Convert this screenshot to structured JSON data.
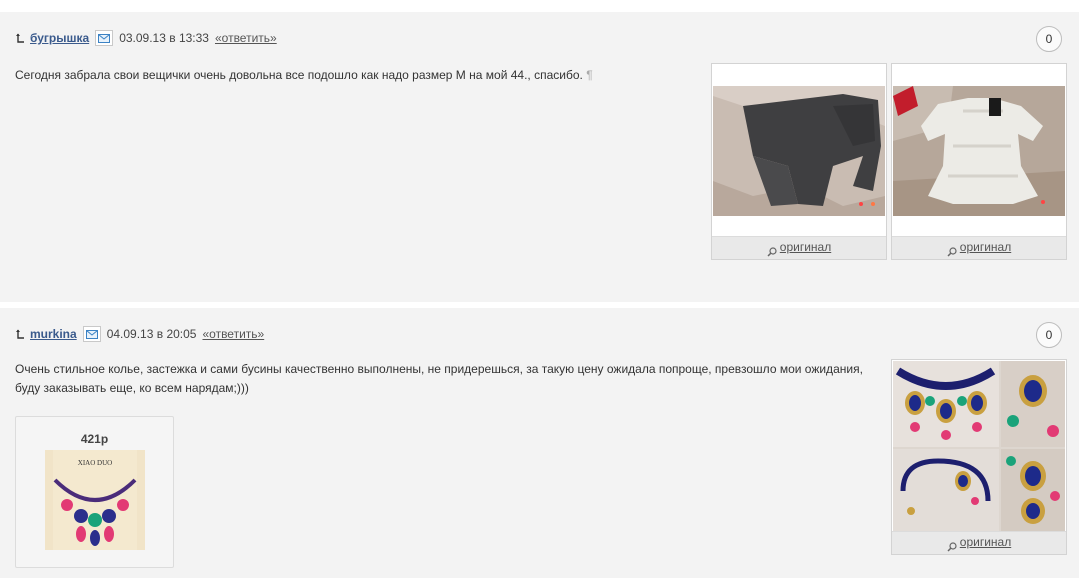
{
  "comments": [
    {
      "author": "бугрышка",
      "date": "03.09.13 в 13:33",
      "reply": "«ответить»",
      "rating": "0",
      "text": "Сегодня забрала свои вещички очень довольна все подошло как надо размер М на мой 44., спасибо.",
      "pilcrow": "¶",
      "photos": [
        {
          "link": "оригинал"
        },
        {
          "link": "оригинал"
        }
      ]
    },
    {
      "author": "murkina",
      "date": "04.09.13 в 20:05",
      "reply": "«ответить»",
      "rating": "0",
      "text": "Очень стильное колье, застежка и сами бусины качественно выполнены, не придерешься, за такую цену ожидала попроще, превзошло мои ожидания, буду заказывать еще, ко всем нарядам;)))",
      "product": {
        "price": "421р",
        "brand": "XIAO DUO"
      },
      "photos": [
        {
          "link": "оригинал"
        }
      ]
    }
  ],
  "icons": {
    "reply_arrow": "reply-arrow-icon",
    "mail": "mail-icon",
    "zoom": "zoom-icon"
  }
}
